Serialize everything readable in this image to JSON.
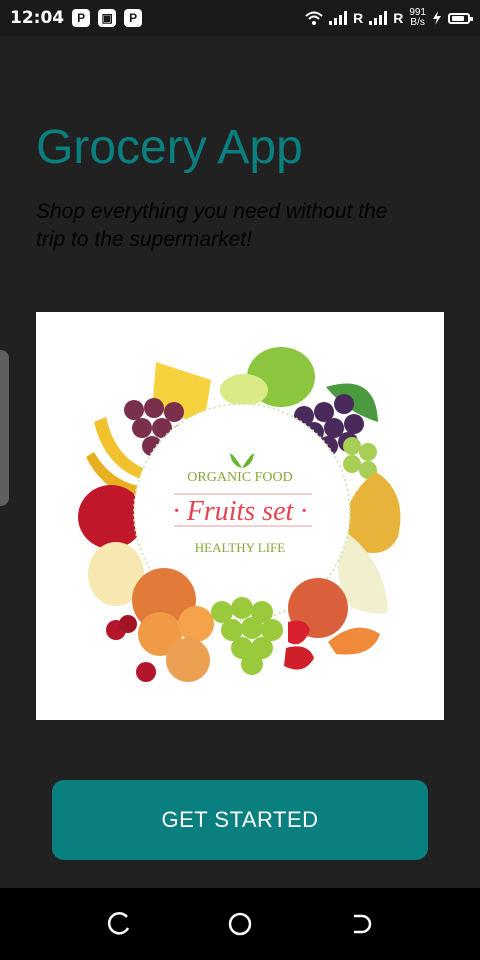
{
  "status_bar": {
    "time": "12:04",
    "notification_icons": [
      "P",
      "▣",
      "P"
    ],
    "network_labels": [
      "R",
      "R"
    ],
    "speed_value": "991",
    "speed_unit": "B/s",
    "icons": [
      "wifi-icon",
      "signal-icon",
      "signal-icon",
      "charging-icon",
      "battery-icon"
    ]
  },
  "header": {
    "title": "Grocery App",
    "subtitle": "Shop everything you need without the trip to the supermarket!"
  },
  "hero_image": {
    "top_label": "ORGANIC FOOD",
    "main_label": "Fruits set",
    "bottom_label": "HEALTHY LIFE"
  },
  "cta": {
    "label": "GET STARTED"
  },
  "colors": {
    "accent": "#0a7f7f",
    "background": "#212121",
    "status_bar": "#1a1a1a",
    "nav_bar": "#000000"
  },
  "nav_bar": {
    "buttons": [
      "back-icon",
      "home-icon",
      "recent-apps-icon"
    ]
  }
}
